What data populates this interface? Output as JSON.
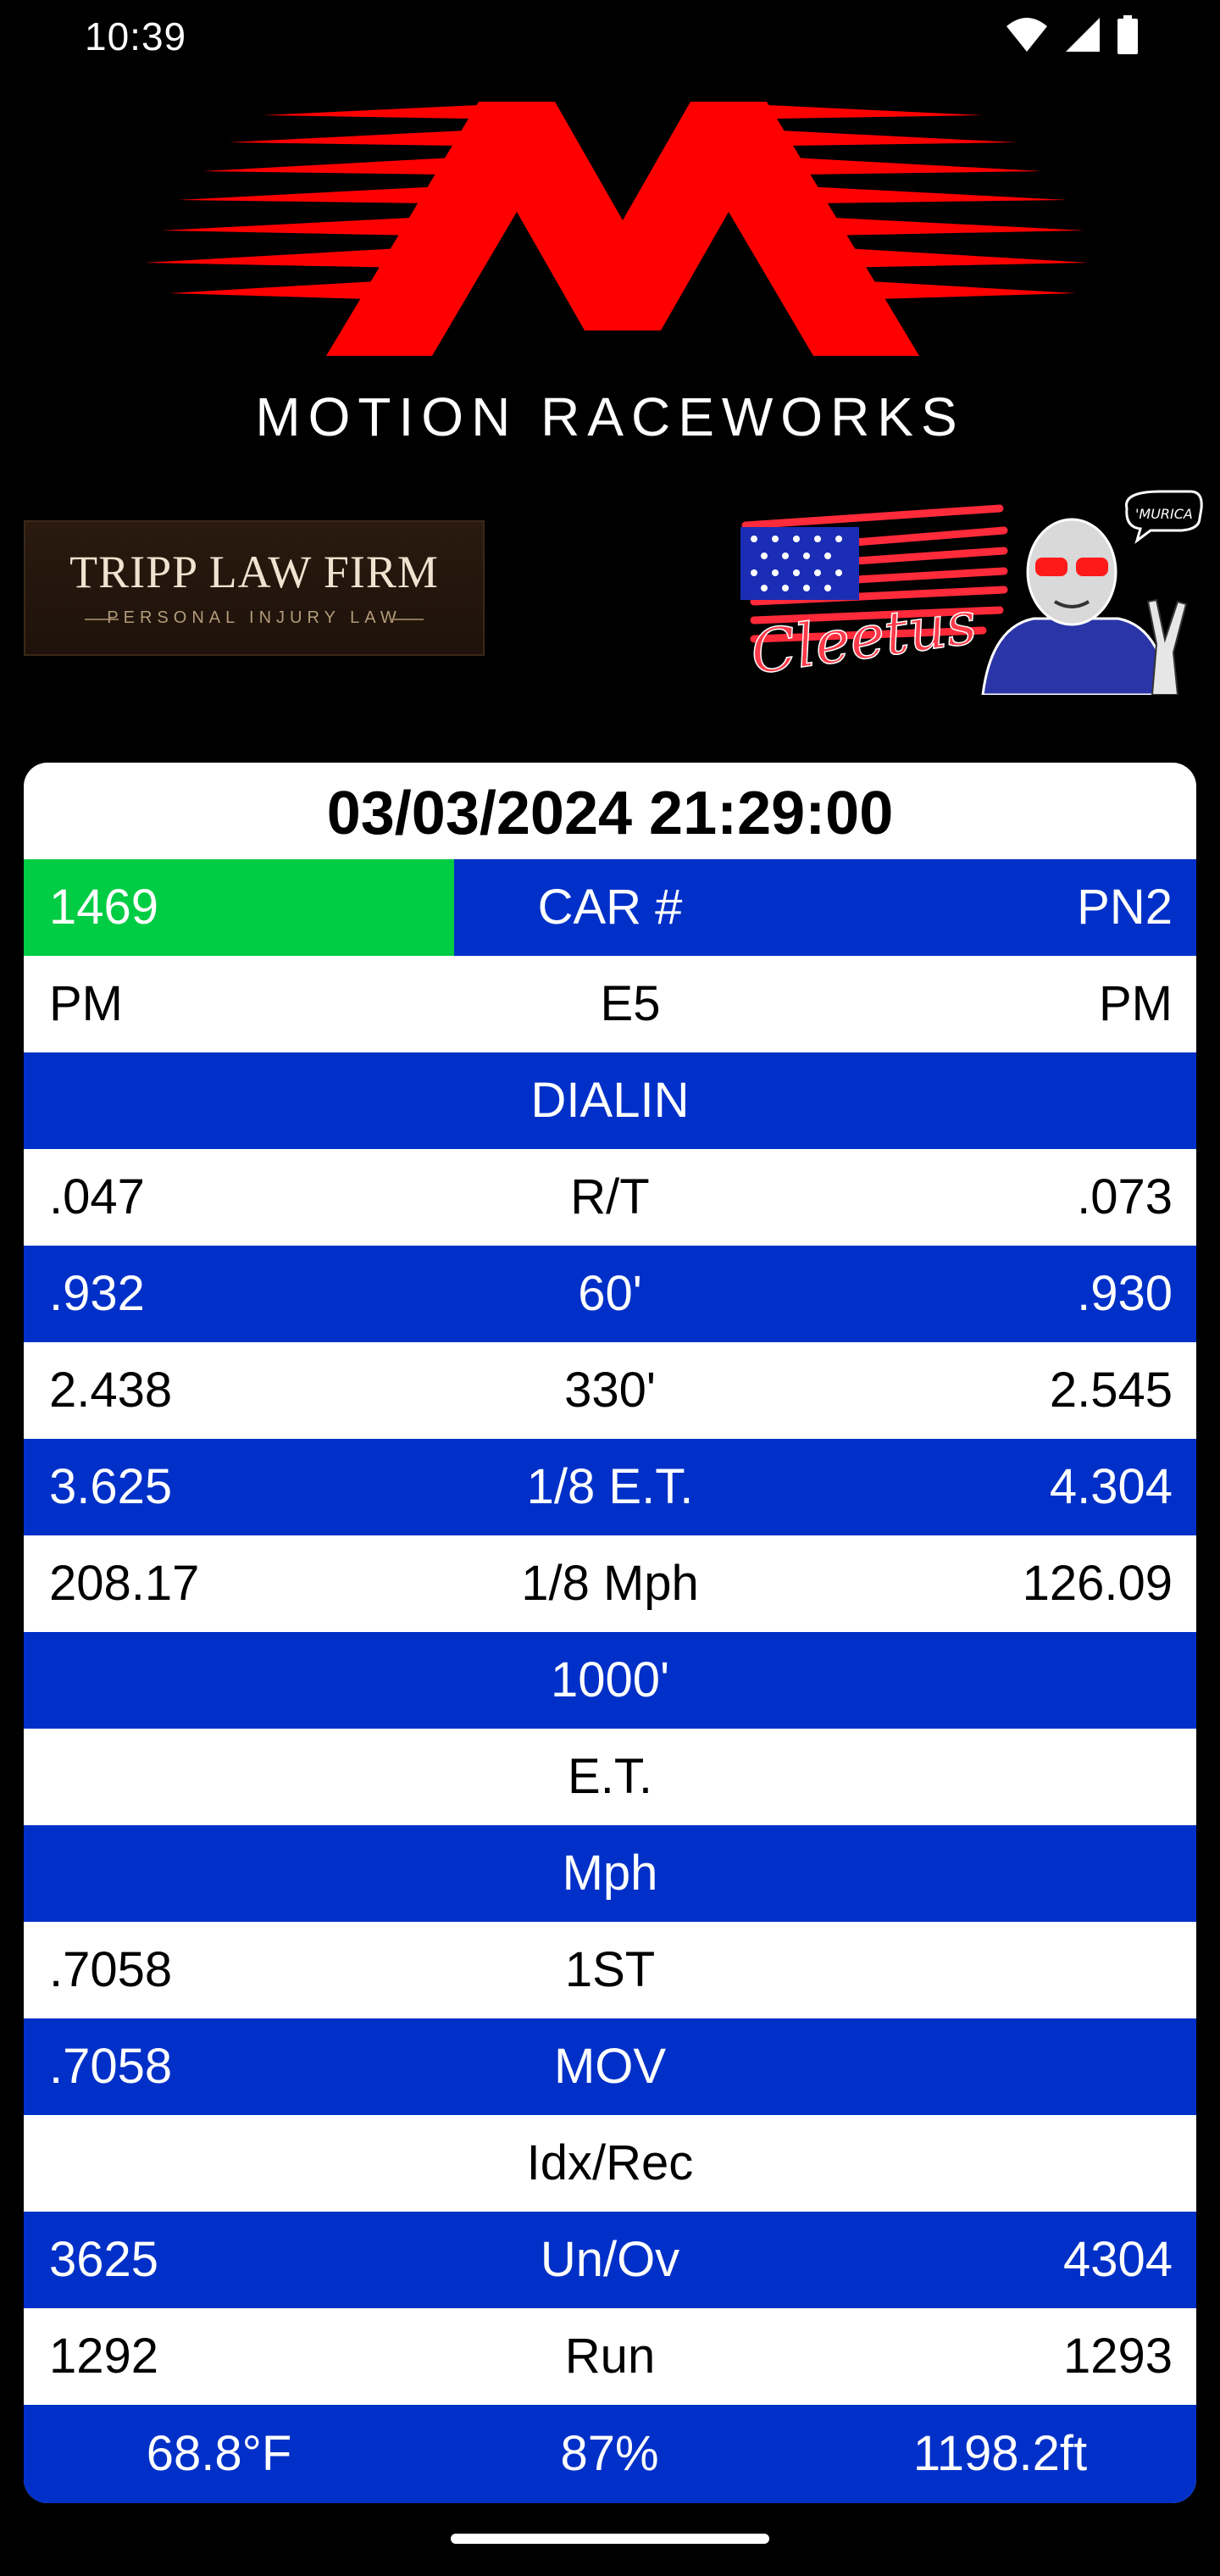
{
  "status_bar": {
    "time": "10:39",
    "icons": [
      "wifi-icon",
      "cell-signal-icon",
      "battery-icon"
    ]
  },
  "sponsors": {
    "motion": {
      "text": "MOTION RACEWORKS",
      "accent": "#ff0000"
    },
    "tripp": {
      "name": "TRIPP LAW FIRM",
      "tagline": "PERSONAL INJURY LAW"
    },
    "cleetus": {
      "script": "Cleetus",
      "bubble": "'MURICA"
    }
  },
  "timeslip": {
    "datetime": "03/03/2024 21:29:00",
    "rows": [
      {
        "left": "1469",
        "center": "CAR #",
        "right": "PN2",
        "style": "blue",
        "left_highlight": "#00cc44"
      },
      {
        "left": "PM",
        "center": "E5",
        "right": "PM",
        "style": "white"
      },
      {
        "left": "",
        "center": "DIALIN",
        "right": "",
        "style": "blue"
      },
      {
        "left": ".047",
        "center": "R/T",
        "right": ".073",
        "style": "white"
      },
      {
        "left": ".932",
        "center": "60'",
        "right": ".930",
        "style": "blue"
      },
      {
        "left": "2.438",
        "center": "330'",
        "right": "2.545",
        "style": "white"
      },
      {
        "left": "3.625",
        "center": "1/8 E.T.",
        "right": "4.304",
        "style": "blue"
      },
      {
        "left": "208.17",
        "center": "1/8 Mph",
        "right": "126.09",
        "style": "white"
      },
      {
        "left": "",
        "center": "1000'",
        "right": "",
        "style": "blue"
      },
      {
        "left": "",
        "center": "E.T.",
        "right": "",
        "style": "white"
      },
      {
        "left": "",
        "center": "Mph",
        "right": "",
        "style": "blue"
      },
      {
        "left": ".7058",
        "center": "1ST",
        "right": "",
        "style": "white"
      },
      {
        "left": ".7058",
        "center": "MOV",
        "right": "",
        "style": "blue"
      },
      {
        "left": "",
        "center": "Idx/Rec",
        "right": "",
        "style": "white"
      },
      {
        "left": "3625",
        "center": "Un/Ov",
        "right": "4304",
        "style": "blue"
      },
      {
        "left": "1292",
        "center": "Run",
        "right": "1293",
        "style": "white"
      }
    ],
    "footer": {
      "temperature": "68.8°F",
      "humidity": "87%",
      "altitude": "1198.2ft"
    }
  },
  "colors": {
    "row_blue": "#0030c8",
    "row_white": "#ffffff",
    "win_green": "#00cc44"
  }
}
